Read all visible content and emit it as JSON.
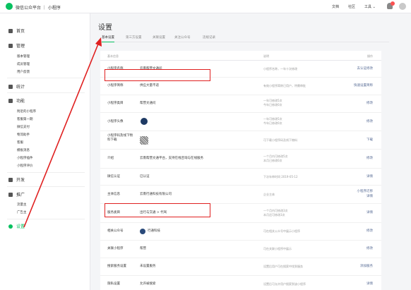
{
  "top": {
    "title": "微信公众平台 ｜ 小程序",
    "docs": "文档",
    "community": "社区",
    "tools": "工具 ⌄"
  },
  "sidebar": {
    "sections": [
      {
        "label": "首页"
      },
      {
        "label": "管理",
        "items": [
          "版本管理",
          "成员管理",
          "用户反馈"
        ]
      },
      {
        "label": "统计"
      },
      {
        "label": "功能",
        "items": [
          "附近的小程序",
          "客服第一期",
          "微信支付",
          "物流助手",
          "客服",
          "模板消息",
          "小程序插件",
          "小程序评价"
        ]
      },
      {
        "label": "开发"
      },
      {
        "label": "推广",
        "items": [
          "流量主",
          "广告主"
        ]
      },
      {
        "label": "设置"
      }
    ]
  },
  "main": {
    "title": "设置",
    "tabs": [
      "基本设置",
      "第三方设置",
      "关联设置",
      "关注公众号",
      "违规记录"
    ],
    "columns": {
      "name": "基本信息",
      "desc": "说明",
      "action": "操作"
    },
    "rows": [
      {
        "name": "小程序名称",
        "value": "云南帮营文通问",
        "desc": [
          "小程序名称，一年十次修改",
          "名称需与公众号关联"
        ],
        "action": "去认证修改"
      },
      {
        "name": "小程序简称",
        "value": "供应大量不适",
        "desc": [
          "有效小程序简称已用户，特需审批"
        ],
        "action": "快速设置简称"
      },
      {
        "name": "小程序类目",
        "value": "帮营文通问",
        "desc": [
          "一年可修改5次",
          "今年已修改0次"
        ],
        "action": "修改"
      },
      {
        "name": "小程序头像",
        "value": "",
        "desc": [
          "一年可修改5次",
          "今年已修改0次"
        ],
        "action": "修改"
      },
      {
        "name": "小程序码及线下物料下载",
        "value": "",
        "desc": [
          "可下载小程序码及线下物料"
        ],
        "action": "下载"
      },
      {
        "name": "介绍",
        "value": "云南帮营文通平台，支持在线咨询与在线服务",
        "desc": [
          "一个月内可修改5次",
          "本月已修改0次"
        ],
        "action": "修改"
      },
      {
        "name": "微信认证",
        "value": "已认证",
        "desc": [
          "下次年审时间 2019-05-12"
        ],
        "action": "详情"
      },
      {
        "name": "主体信息",
        "value": "云南行通科技有限公司",
        "desc": [
          "企业主体"
        ],
        "action": [
          "小程序迁移",
          "详情"
        ]
      },
      {
        "name": "服务类目",
        "value": "出行与交通 > 代驾",
        "desc": [
          "一个月内可修改3次",
          "本月还可修改3次"
        ],
        "action": "详情"
      },
      {
        "name": "相关公众号",
        "value": "行通科技",
        "desc": [
          "可在相关公众号中展示小程序"
        ],
        "action": "修改"
      },
      {
        "name": "关联小程序",
        "value": "帮营",
        "desc": [
          "可在关联小程序中展示"
        ],
        "action": "修改"
      },
      {
        "name": "搜索服务设置",
        "value": "未设置服务",
        "desc": [
          "设置后用户可在搜索中找到服务"
        ],
        "action": "添加服务"
      },
      {
        "name": "隐私设置",
        "value": "允许被搜索",
        "desc": [
          "设置后可允许用户搜索到该小程序"
        ],
        "action": "详情"
      }
    ]
  },
  "colors": {
    "accent": "#07c160",
    "link": "#576b95",
    "annotation": "#e02020"
  }
}
